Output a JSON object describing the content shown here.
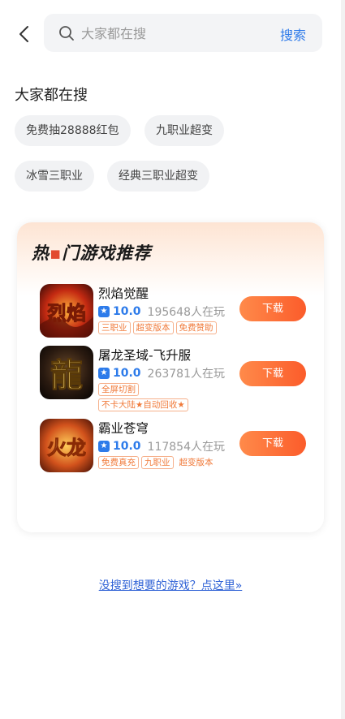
{
  "search": {
    "placeholder": "大家都在搜",
    "button_label": "搜索"
  },
  "popular": {
    "title": "大家都在搜",
    "chips": [
      "免费抽28888红包",
      "九职业超变",
      "冰雪三职业",
      "经典三职业超变"
    ]
  },
  "recommend": {
    "title_part1": "热",
    "title_part2": "门游戏推荐",
    "games": [
      {
        "name": "烈焰觉醒",
        "score": "10.0",
        "players": "195648人在玩",
        "tags": [
          "三职业",
          "超变版本",
          "免费赞助"
        ],
        "download_label": "下载",
        "icon_text": "烈焰"
      },
      {
        "name": "屠龙圣域-飞升服",
        "score": "10.0",
        "players": "263781人在玩",
        "tags": [
          "全屏切割",
          "不卡大陆★自动回收★"
        ],
        "download_label": "下载",
        "icon_text": "龍"
      },
      {
        "name": "霸业苍穹",
        "score": "10.0",
        "players": "117854人在玩",
        "tags": [
          "免费真充",
          "九职业",
          "超变版本"
        ],
        "download_label": "下载",
        "icon_text": "火龙"
      }
    ]
  },
  "footer": {
    "link_text": "没搜到想要的游戏？点这里»"
  },
  "colors": {
    "accent": "#2f7bea",
    "download": "#fb6a31",
    "tag": "#f07a3a"
  }
}
